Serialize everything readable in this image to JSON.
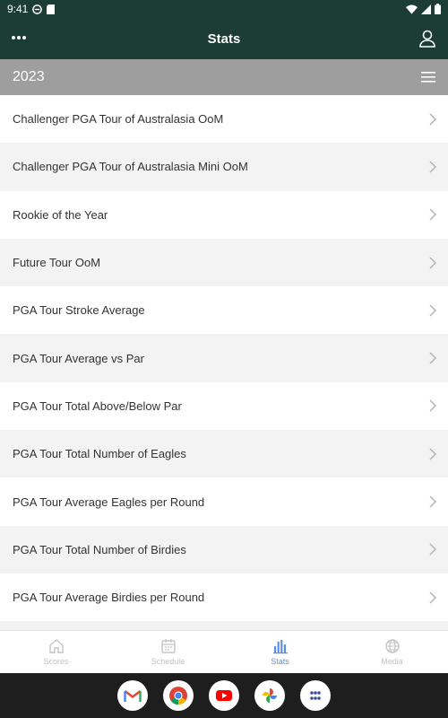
{
  "status_bar": {
    "time": "9:41"
  },
  "app_bar": {
    "title": "Stats"
  },
  "season": {
    "year": "2023"
  },
  "stats_list": [
    {
      "label": "Challenger PGA Tour of Australasia OoM"
    },
    {
      "label": "Challenger PGA Tour of Australasia Mini OoM"
    },
    {
      "label": "Rookie of the Year"
    },
    {
      "label": "Future Tour OoM"
    },
    {
      "label": "PGA Tour Stroke Average"
    },
    {
      "label": "PGA Tour Average vs Par"
    },
    {
      "label": "PGA Tour Total Above/Below Par"
    },
    {
      "label": "PGA Tour Total Number of Eagles"
    },
    {
      "label": "PGA Tour Average Eagles per Round"
    },
    {
      "label": "PGA Tour Total Number of Birdies"
    },
    {
      "label": "PGA Tour Average Birdies per Round"
    }
  ],
  "bottom_nav": {
    "items": [
      {
        "label": "Scores",
        "icon": "home-icon",
        "active": false
      },
      {
        "label": "Schedule",
        "icon": "calendar-icon",
        "active": false
      },
      {
        "label": "Stats",
        "icon": "bar-chart-icon",
        "active": true
      },
      {
        "label": "Media",
        "icon": "globe-icon",
        "active": false
      }
    ]
  },
  "dock": {
    "apps": [
      {
        "icon": "gmail-icon"
      },
      {
        "icon": "chrome-icon"
      },
      {
        "icon": "youtube-icon"
      },
      {
        "icon": "photos-icon"
      },
      {
        "icon": "app-drawer-icon"
      }
    ]
  },
  "colors": {
    "header_bg": "#1c3d35",
    "season_bar_bg": "#9e9e9e",
    "row_alt_bg": "#f3f3f3",
    "nav_active": "#5f8fe0",
    "nav_inactive": "#c4c4c4",
    "dock_bg": "#1e1e1e"
  }
}
